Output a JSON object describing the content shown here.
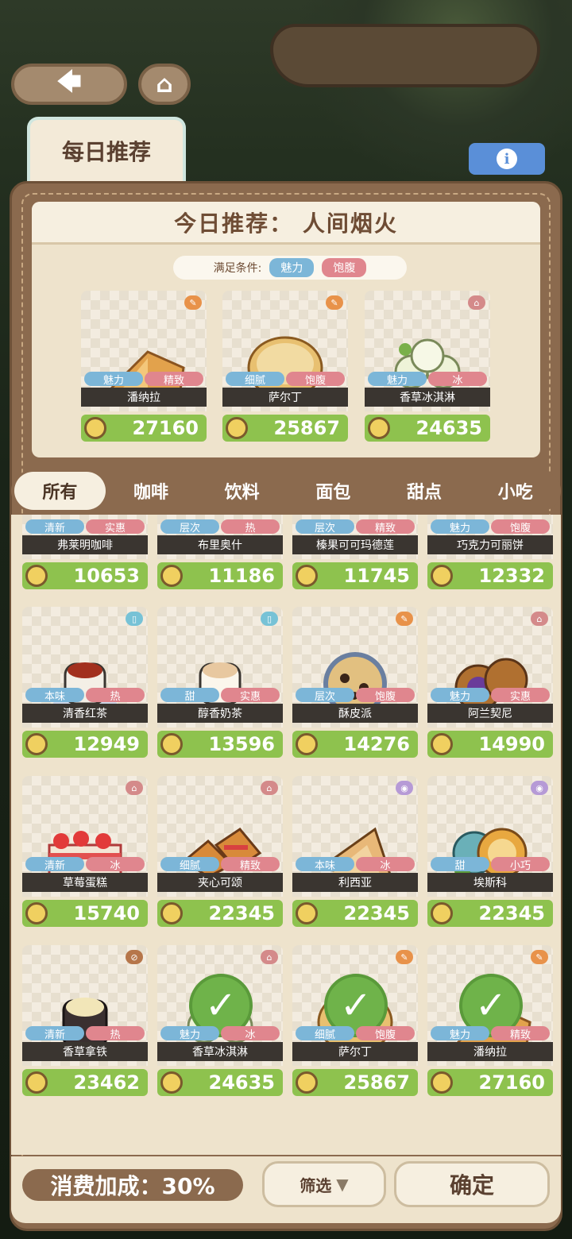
{
  "colors": {
    "price_green": "#8ec24e",
    "tag_blue": "#7cb6d8",
    "tag_pink": "#e0868e",
    "frame_brown": "#8b6a4e",
    "info_blue": "#5a8fd8"
  },
  "nav": {
    "back_icon": "arrow-left-icon",
    "home_icon": "home-icon"
  },
  "daily_tab": {
    "label": "每日推荐"
  },
  "info_icon": "i",
  "recommend": {
    "title": "今日推荐： 人间烟火",
    "condition_label": "满足条件:",
    "conditions": [
      "魅力",
      "饱腹"
    ],
    "items": [
      {
        "name": "潘纳拉",
        "tags": [
          "魅力",
          "精致"
        ],
        "price": "27160",
        "badge": "✎"
      },
      {
        "name": "萨尔丁",
        "tags": [
          "细腻",
          "饱腹"
        ],
        "price": "25867",
        "badge": "✎"
      },
      {
        "name": "香草冰淇淋",
        "tags": [
          "魅力",
          "冰"
        ],
        "price": "24635",
        "badge": "⌂"
      }
    ]
  },
  "categories": [
    "所有",
    "咖啡",
    "饮料",
    "面包",
    "甜点",
    "小吃"
  ],
  "list": [
    {
      "name": "弗莱明咖啡",
      "tags": [
        "清新",
        "实惠"
      ],
      "price": "10653"
    },
    {
      "name": "布里奥什",
      "tags": [
        "层次",
        "热"
      ],
      "price": "11186"
    },
    {
      "name": "榛果可可玛德莲",
      "tags": [
        "层次",
        "精致"
      ],
      "price": "11745"
    },
    {
      "name": "巧克力可丽饼",
      "tags": [
        "魅力",
        "饱腹"
      ],
      "price": "12332"
    },
    {
      "name": "清香红茶",
      "tags": [
        "本味",
        "热"
      ],
      "price": "12949"
    },
    {
      "name": "醇香奶茶",
      "tags": [
        "甜",
        "实惠"
      ],
      "price": "13596"
    },
    {
      "name": "酥皮派",
      "tags": [
        "层次",
        "饱腹"
      ],
      "price": "14276"
    },
    {
      "name": "阿兰契尼",
      "tags": [
        "魅力",
        "实惠"
      ],
      "price": "14990"
    },
    {
      "name": "草莓蛋糕",
      "tags": [
        "清新",
        "冰"
      ],
      "price": "15740"
    },
    {
      "name": "夹心可颂",
      "tags": [
        "细腻",
        "精致"
      ],
      "price": "22345"
    },
    {
      "name": "利西亚",
      "tags": [
        "本味",
        "冰"
      ],
      "price": "22345"
    },
    {
      "name": "埃斯科",
      "tags": [
        "甜",
        "小巧"
      ],
      "price": "22345"
    },
    {
      "name": "香草拿铁",
      "tags": [
        "清新",
        "热"
      ],
      "price": "23462"
    },
    {
      "name": "香草冰淇淋",
      "tags": [
        "魅力",
        "冰"
      ],
      "price": "24635"
    },
    {
      "name": "萨尔丁",
      "tags": [
        "细腻",
        "饱腹"
      ],
      "price": "25867"
    },
    {
      "name": "潘纳拉",
      "tags": [
        "魅力",
        "精致"
      ],
      "price": "27160"
    }
  ],
  "bottom": {
    "bonus": "消费加成：30%",
    "filter": "筛选",
    "confirm": "确定"
  }
}
